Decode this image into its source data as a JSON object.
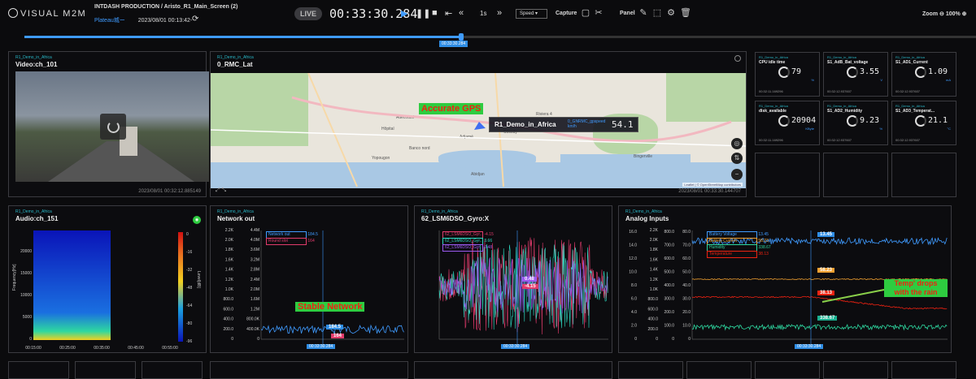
{
  "app": {
    "logo": "VISUAL M2M",
    "project": "INTDASH PRODUCTION / Aristo_R1_Main_Screen (2)",
    "place": "Plateau城ー",
    "datetime": "2023/08/01 00:13:42-"
  },
  "player": {
    "live": "LIVE",
    "clock": "00:33:30.284",
    "step": "1s",
    "speed_label": "Speed",
    "capture_label": "Capture",
    "panel_label": "Panel",
    "zoom_label": "Zoom",
    "zoom_value": "100%",
    "timeline_stamp": "00:33:30.284",
    "timeline_position": 0.46
  },
  "panels": {
    "video": {
      "tag": "R1_Demo_in_Africa",
      "title": "Video:ch_101",
      "stamp": "2023/08/01 00:32:12.885149"
    },
    "map": {
      "tag": "R1_Demo_in_Africa",
      "title": "0_RMC_Lat",
      "stamp": "2023/08/01 00:33:30.144707",
      "annotation": "Accurate GPS",
      "popup_name": "R1_Demo_in_Africa",
      "popup_key": "0_GNRMC_gpspeed km/h",
      "popup_value": "54.1",
      "attribution": "Leaflet | © OpenStreetMap contributors",
      "places": [
        "Attécoubé",
        "Adjamé",
        "Cocody",
        "Yopougon",
        "Abidjan",
        "Bingerville",
        "Riviera 4",
        "Hôpital",
        "Banco nord",
        "Bingerville"
      ]
    },
    "audio": {
      "tag": "R1_Demo_in_Africa",
      "title": "Audio:ch_151",
      "ylabel": "Frequency[Hz]",
      "cbar_label": "Level[dB]",
      "xticks": [
        "00:15:00",
        "00:25:00",
        "00:35:00",
        "00:45:00",
        "00:55:00"
      ],
      "yticks": [
        "0",
        "5000",
        "10000",
        "15000",
        "20000"
      ],
      "cticks": [
        "0",
        "-16",
        "-32",
        "-48",
        "-64",
        "-80",
        "-96"
      ]
    },
    "network": {
      "tag": "R1_Demo_in_Africa",
      "title": "Network out",
      "annotation": "Stable Network",
      "legend": [
        {
          "name": "Network out",
          "value": "184.5",
          "color": "#3f9bff"
        },
        {
          "name": "Round slot",
          "value": "164",
          "color": "#e23b6c"
        }
      ],
      "badge1": "184.5",
      "badge2": "164",
      "stamp": "00:33:30.284",
      "yticks_left": [
        "0",
        "200.0",
        "400.0",
        "600.0",
        "800.0",
        "1.0K",
        "1.2K",
        "1.4K",
        "1.6K",
        "1.8K",
        "2.0K",
        "2.2K"
      ],
      "yticks_right": [
        "0",
        "400.0K",
        "800.0K",
        "1.2M",
        "1.6M",
        "2.0M",
        "2.4M",
        "2.8M",
        "3.2M",
        "3.6M",
        "4.0M",
        "4.4M"
      ]
    },
    "gyro": {
      "tag": "R1_Demo_in_Africa",
      "title": "62_LSM6DSO_Gyro:X",
      "legend": [
        {
          "name": "62_LSM6DSO_Gyr...",
          "value": "-4.15",
          "color": "#e23b6c"
        },
        {
          "name": "62_LSM6DSO_Gyr...",
          "value": "3.66",
          "color": "#2ed8c0"
        },
        {
          "name": "62_LSM6DSO_Gyr...",
          "value": "0.48",
          "color": "#9b59f0"
        }
      ],
      "badge1": "0.48",
      "badge2": "-4.15",
      "stamp": "00:33:30.284"
    },
    "analog": {
      "tag": "R1_Demo_in_Africa",
      "title": "Analog Inputs",
      "annotation": "Temp' drops with the rain",
      "legend": [
        {
          "name": "Battery Voltage",
          "value": "13.45",
          "color": "#3f9bff"
        },
        {
          "name": "Battery Current",
          "value": "58.23",
          "color": "#f0a030"
        },
        {
          "name": "Humidity",
          "value": "338.67",
          "color": "#2ed8a0"
        },
        {
          "name": "Temperature",
          "value": "38.13",
          "color": "#e21"
        }
      ],
      "badges": [
        "13.45",
        "58.23",
        "38.13",
        "338.67"
      ],
      "stamp": "00:33:30.284",
      "yticks_a": [
        "0",
        "2.0",
        "4.0",
        "6.0",
        "8.0",
        "10.0",
        "12.0",
        "14.0",
        "16.0"
      ],
      "yticks_b": [
        "0",
        "200.0",
        "400.0",
        "600.0",
        "800.0",
        "1.0K",
        "1.2K",
        "1.4K",
        "1.6K",
        "1.8K",
        "2.0K",
        "2.2K"
      ],
      "yticks_c": [
        "0",
        "100.0",
        "200.0",
        "300.0",
        "400.0",
        "500.0",
        "600.0",
        "700.0",
        "800.0"
      ],
      "yticks_d": [
        "0",
        "10.0",
        "20.0",
        "30.0",
        "40.0",
        "50.0",
        "60.0",
        "70.0",
        "80.0"
      ]
    }
  },
  "minis": [
    {
      "tag": "R1_Demo_in_Africa",
      "label": "CPU idle time",
      "value": "79",
      "unit": "%",
      "stamp": "00:32:11.169296"
    },
    {
      "tag": "R1_Demo_in_Africa",
      "label": "S1_AdB_Bat_voltage",
      "value": "3.55",
      "unit": "V",
      "stamp": "00:32:12.937607"
    },
    {
      "tag": "R1_Demo_in_Africa",
      "label": "S1_AD1_Current",
      "value": "1.09",
      "unit": "mA",
      "stamp": "00:32:12.937607"
    },
    {
      "tag": "R1_Demo_in_Africa",
      "label": "disk_available",
      "value": "20904",
      "unit": "KByte",
      "stamp": "00:32:11.169296"
    },
    {
      "tag": "R1_Demo_in_Africa",
      "label": "S1_AD2_Humidity",
      "value": "9.23",
      "unit": "%",
      "stamp": "00:32:12.937607"
    },
    {
      "tag": "R1_Demo_in_Africa",
      "label": "S1_AD3_Temperat...",
      "value": "21.1",
      "unit": "°C",
      "stamp": "00:32:12.937607"
    }
  ]
}
